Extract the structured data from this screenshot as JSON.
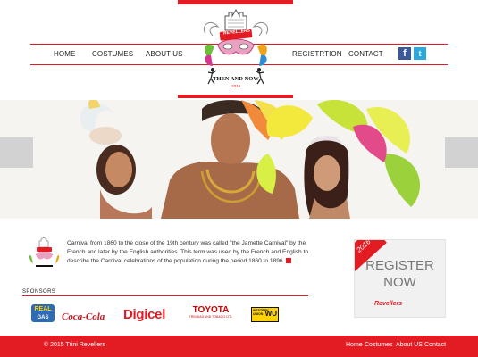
{
  "nav": {
    "left": [
      "HOME",
      "COSTUMES",
      "ABOUT US"
    ],
    "right": [
      "REGISTRTION",
      "CONTACT"
    ],
    "social": [
      "f",
      "t"
    ]
  },
  "logo": {
    "badge": "REVELLERS",
    "tagline": "THEN AND NOW",
    "year": "2016"
  },
  "intro": {
    "text": "Carnival from 1860 to the close of the 19th century was called \"the Jamette Carnival\" by the French and later by the English authorities. This term was used by the French and English to describe the Carnival celebrations of the population during the period 1860 to 1896."
  },
  "register": {
    "year": "2016",
    "line1": "REGISTER",
    "line2": "NOW",
    "brand": "Revellers"
  },
  "sponsors": {
    "label": "SPONSORS",
    "items": [
      {
        "name": "REAL",
        "sub": "GAS",
        "color": "#2f6bb5"
      },
      {
        "name": "Coca-Cola",
        "color": "#c5161d"
      },
      {
        "name": "Digicel",
        "color": "#e31b23"
      },
      {
        "name": "TOYOTA",
        "sub": "TRINIDAD AND TOBAGO LTD.",
        "color": "#cc0000"
      },
      {
        "name": "WESTERN UNION",
        "sub": "WU",
        "color": "#ffd200"
      }
    ]
  },
  "footer": {
    "copyright": "© 2015 Trini Revellers",
    "links": [
      "Home",
      "Costumes",
      "About US",
      "Contact"
    ]
  },
  "colors": {
    "accent": "#e31b23",
    "slider_button": "#d2d2d2"
  }
}
